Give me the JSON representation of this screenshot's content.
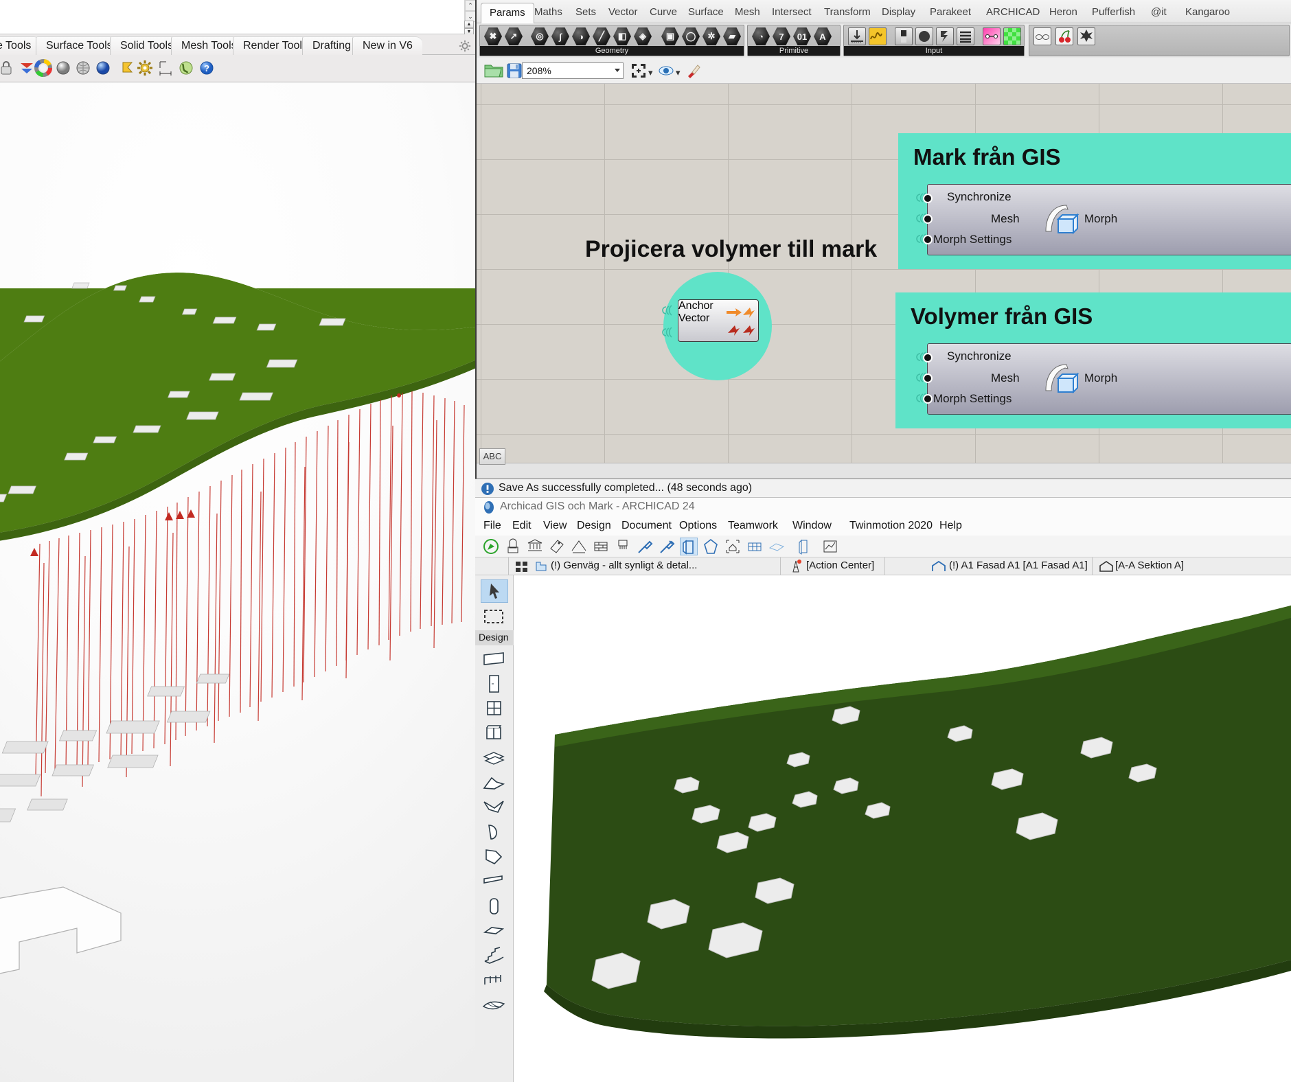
{
  "rhino": {
    "tabs": [
      "e Tools",
      "Surface Tools",
      "Solid Tools",
      "Mesh Tools",
      "Render Tools",
      "Drafting",
      "New in V6"
    ],
    "toolbar_icons": [
      "lock-icon",
      "layer-icon",
      "color-wheel-icon",
      "shade-sphere-icon",
      "mesh-sphere-icon",
      "render-sphere-icon",
      "flag-icon",
      "gear-icon",
      "dim-icon",
      "earth-icon",
      "help-icon"
    ],
    "scroll_up": "⌃",
    "scroll_down": "⌄",
    "spin_up": "▲",
    "spin_down": "▼",
    "gear": "gear-icon",
    "viewport_name": "rhino-perspective-viewport"
  },
  "grasshopper": {
    "tabs": [
      "Params",
      "Maths",
      "Sets",
      "Vector",
      "Curve",
      "Surface",
      "Mesh",
      "Intersect",
      "Transform",
      "Display",
      "Parakeet",
      "ARCHICAD",
      "Heron",
      "Pufferfish",
      "@it",
      "Kangaroo"
    ],
    "active_tab": "Params",
    "groups": [
      {
        "name": "Geometry",
        "label": "Geometry",
        "icons": [
          "x-param-icon",
          "arrow-param-icon",
          "point-icon",
          "curve-icon",
          "surface-icon",
          "line-icon",
          "brep-icon",
          "mesh-icon",
          "box-icon",
          "circle-icon",
          "snowflake-icon",
          "plane-icon"
        ]
      },
      {
        "name": "Primitive",
        "label": "Primitive",
        "icons": [
          "boolean-icon",
          "integer-icon",
          "number-icon",
          "text-icon"
        ]
      },
      {
        "name": "Input",
        "label": "Input",
        "icons": [
          "slider-icon",
          "graph-mapper-icon",
          "button-icon",
          "knob-icon",
          "value-list-icon",
          "panel-icon",
          "gradient-icon",
          "colour-swatch-icon"
        ]
      },
      {
        "name": "Kangaroo",
        "label": "",
        "icons": [
          "glasses-icon",
          "cherries-icon",
          "explode-icon"
        ]
      }
    ],
    "toolbar": {
      "open_icon": "open-folder-icon",
      "save_icon": "save-disk-icon",
      "zoom_value": "208%",
      "fit_icon": "zoom-extents-icon",
      "preview_icon": "eye-icon",
      "bake_icon": "bake-icon"
    },
    "canvas": {
      "annotation": "Projicera volymer till mark",
      "cluster_color": "#5fe3c8",
      "clusters": [
        {
          "title": "Mark från GIS",
          "component": {
            "name": "archicad-morph-component",
            "inputs": [
              "Synchronize",
              "Mesh",
              "Morph Settings"
            ],
            "output": "Morph",
            "icon": "morph-icon"
          }
        },
        {
          "title": "Volymer från GIS",
          "component": {
            "name": "archicad-morph-component",
            "inputs": [
              "Synchronize",
              "Mesh",
              "Morph Settings"
            ],
            "output": "Morph",
            "icon": "morph-icon"
          }
        }
      ],
      "project_component": {
        "name": "project-component",
        "inputs": [
          "Anchor",
          "Vector"
        ],
        "icon": "project-vector-icon"
      }
    },
    "statusbar": {
      "abc_tab": "ABC"
    }
  },
  "archicad": {
    "message": "Save As successfully completed... (48 seconds ago)",
    "message_icon": "info-icon",
    "window_title": "Archicad GIS och Mark - ARCHICAD 24",
    "app_icon": "archicad-icon",
    "menu": [
      "File",
      "Edit",
      "View",
      "Design",
      "Document",
      "Options",
      "Teamwork",
      "Window",
      "Twinmotion 2020",
      "Help"
    ],
    "toolbar_icons": [
      "arrow-compass-icon",
      "marquee-3d-icon",
      "column-icon",
      "tag-icon",
      "dimension-icon",
      "wall-icon",
      "paint-icon",
      "eyedropper-icon",
      "syringe-icon",
      "door-icon",
      "morph-icon",
      "home-icon",
      "grid-icon",
      "mesh-icon",
      "slab-icon",
      "chart-icon"
    ],
    "quickbar": {
      "grid_icon": "grid-view-icon",
      "layer_icon": "layer-combination-icon",
      "layer_label": "(!) Genväg - allt synligt & detal...",
      "action_center_icon": "action-center-icon",
      "action_center_label": "[Action Center]",
      "facade_icon": "elevation-icon",
      "facade_label": "(!) A1 Fasad A1 [A1 Fasad A1]",
      "section_icon": "section-icon",
      "section_label": "[A-A Sektion A]"
    },
    "toolbox": {
      "group_label": "Design",
      "tools": [
        {
          "name": "arrow-tool",
          "selected": true
        },
        {
          "name": "marquee-tool",
          "selected": false
        },
        {
          "name": "wall-tool",
          "selected": false
        },
        {
          "name": "door-tool",
          "selected": false
        },
        {
          "name": "window-tool",
          "selected": false
        },
        {
          "name": "skylight-tool",
          "selected": false
        },
        {
          "name": "slab-tool",
          "selected": false
        },
        {
          "name": "roof-tool",
          "selected": false
        },
        {
          "name": "shell-tool",
          "selected": false
        },
        {
          "name": "curtain-wall-tool",
          "selected": false
        },
        {
          "name": "morph-tool",
          "selected": false
        },
        {
          "name": "beam-tool",
          "selected": false
        },
        {
          "name": "column-tool",
          "selected": false
        },
        {
          "name": "object-tool",
          "selected": false
        },
        {
          "name": "stair-tool",
          "selected": false
        },
        {
          "name": "railing-tool",
          "selected": false
        },
        {
          "name": "mesh-tool",
          "selected": false
        }
      ]
    },
    "viewport_name": "archicad-3d-window"
  }
}
